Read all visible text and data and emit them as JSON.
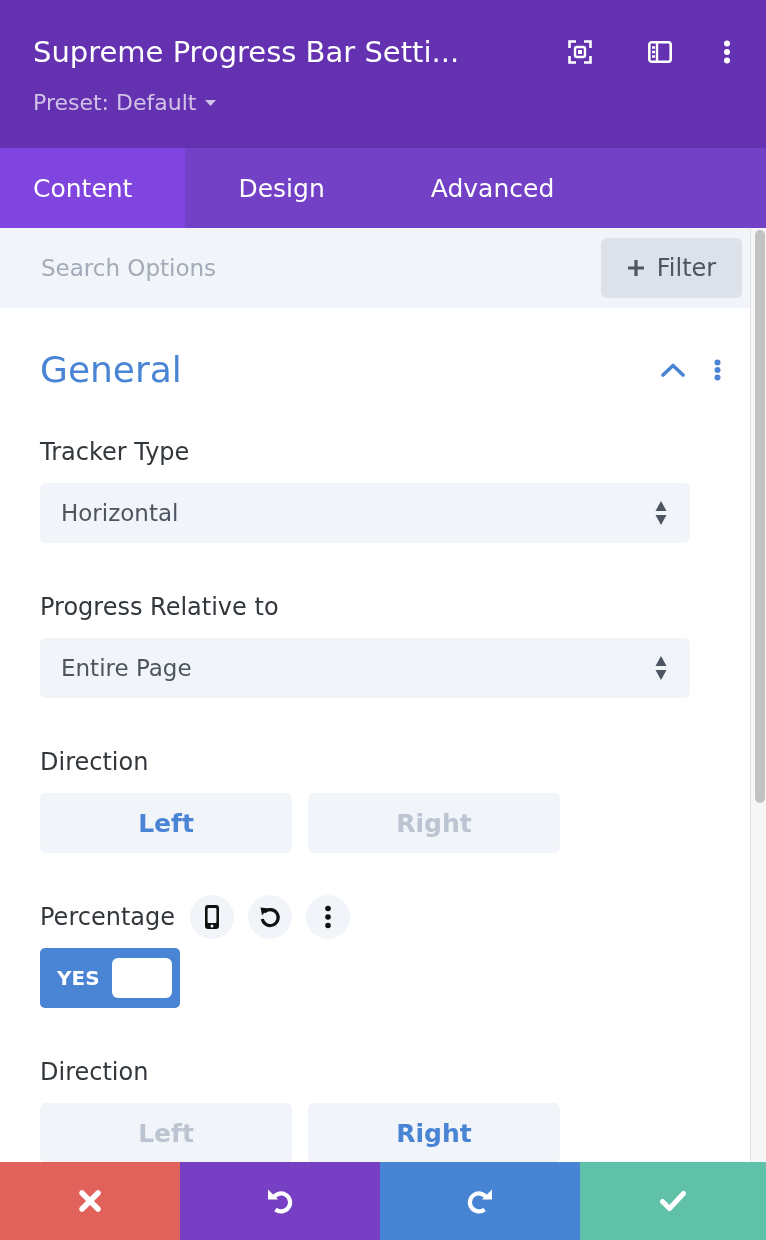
{
  "header": {
    "title": "Supreme Progress Bar Setti...",
    "preset": "Preset: Default"
  },
  "tabs": [
    {
      "label": "Content",
      "selected": true
    },
    {
      "label": "Design",
      "selected": false
    },
    {
      "label": "Advanced",
      "selected": false
    }
  ],
  "search": {
    "placeholder": "Search Options",
    "filter_label": "Filter"
  },
  "section": {
    "title": "General",
    "expanded": true,
    "fields": [
      {
        "kind": "select",
        "label": "Tracker Type",
        "value": "Horizontal",
        "hovered": false
      },
      {
        "kind": "select",
        "label": "Progress Relative to",
        "value": "Entire Page",
        "hovered": false
      },
      {
        "kind": "segmented",
        "label": "Direction",
        "hovered": false,
        "options": [
          {
            "label": "Left",
            "selected": true
          },
          {
            "label": "Right",
            "selected": false
          }
        ]
      },
      {
        "kind": "toggle",
        "label": "Percentage",
        "hovered": true,
        "on": true,
        "value": "YES"
      },
      {
        "kind": "segmented",
        "label": "Direction",
        "hovered": false,
        "options": [
          {
            "label": "Left",
            "selected": false
          },
          {
            "label": "Right",
            "selected": true
          }
        ]
      }
    ]
  },
  "footer_buttons": [
    {
      "kind": "close"
    },
    {
      "kind": "undo"
    },
    {
      "kind": "redo"
    },
    {
      "kind": "save"
    }
  ]
}
